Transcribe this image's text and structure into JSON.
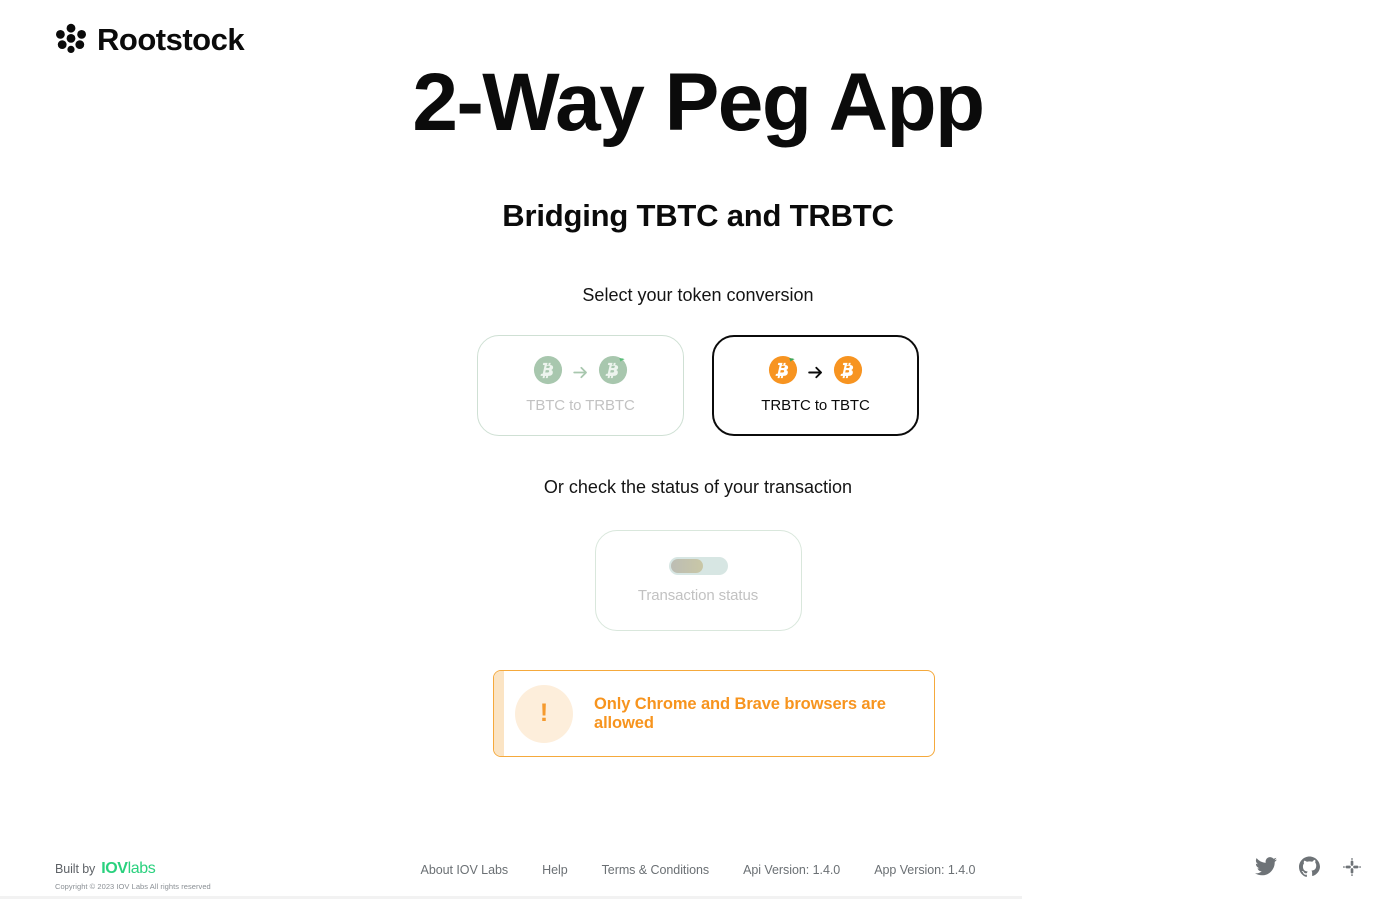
{
  "brand": {
    "name": "Rootstock",
    "mark_icon": "rootstock-flower-icon"
  },
  "hero": {
    "title": "2-Way Peg App",
    "subtitle": "Bridging TBTC and TRBTC"
  },
  "sections": {
    "select_label": "Select your token conversion",
    "status_label": "Or check the status of your transaction"
  },
  "conversion_cards": [
    {
      "label": "TBTC to TRBTC",
      "state": "disabled",
      "from_icon": "tbtc-coin-icon",
      "to_icon": "trbtc-coin-icon",
      "arrow_icon": "arrow-right-icon"
    },
    {
      "label": "TRBTC to TBTC",
      "state": "selected",
      "from_icon": "trbtc-coin-icon",
      "to_icon": "tbtc-coin-icon",
      "arrow_icon": "arrow-right-icon"
    }
  ],
  "transaction_status": {
    "label": "Transaction status",
    "state": "disabled",
    "icon": "status-pill-icon"
  },
  "warning": {
    "icon": "exclamation-icon",
    "icon_glyph": "!",
    "message": "Only Chrome and Brave browsers are allowed",
    "accent_color": "#f7941e",
    "border_color": "#f5a93c",
    "icon_bg_color": "#fdeedb"
  },
  "footer": {
    "built_by_text": "Built by",
    "built_by_logo_bold": "IOV",
    "built_by_logo_light": "labs",
    "copyright": "Copyright © 2023 IOV Labs All rights reserved",
    "links": [
      {
        "label": "About IOV Labs",
        "interactable": true
      },
      {
        "label": "Help",
        "interactable": true
      },
      {
        "label": "Terms & Conditions",
        "interactable": true
      },
      {
        "label": "Api Version: 1.4.0",
        "interactable": false
      },
      {
        "label": "App Version: 1.4.0",
        "interactable": false
      }
    ],
    "socials": [
      {
        "name": "twitter-icon"
      },
      {
        "name": "github-icon"
      },
      {
        "name": "slack-icon"
      }
    ]
  },
  "colors": {
    "brand_green": "#2ad17e",
    "accent_orange": "#f7941e",
    "disabled_green": "#a8c7ae",
    "text_dark": "#0b0b0b",
    "text_muted": "#6b7074"
  }
}
